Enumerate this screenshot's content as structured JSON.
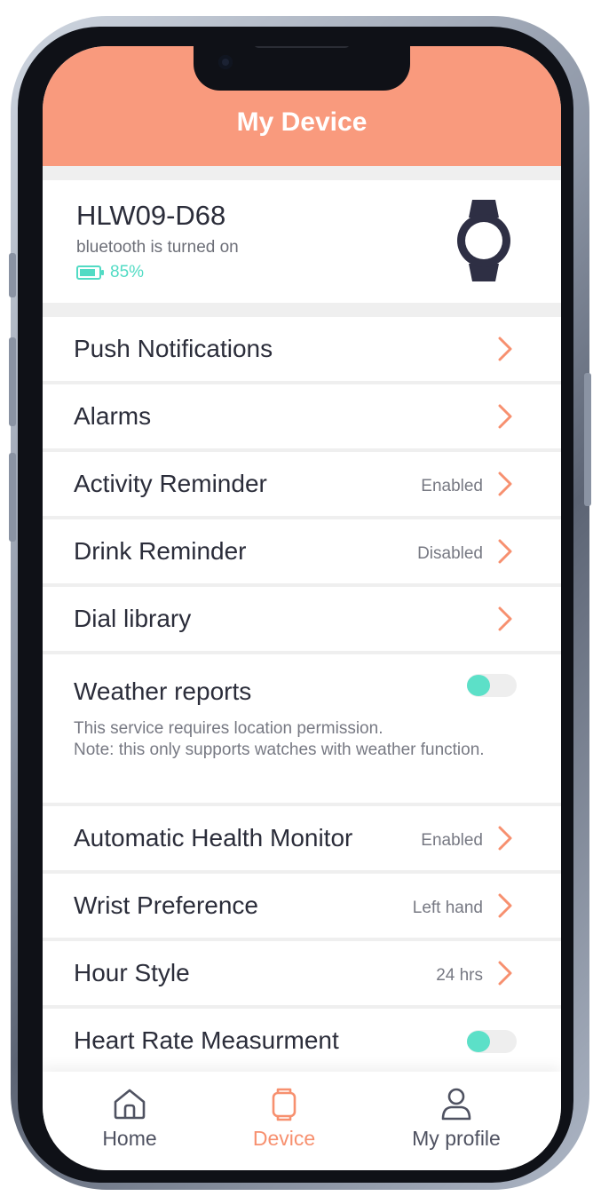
{
  "header": {
    "title": "My Device"
  },
  "device": {
    "name": "HLW09-D68",
    "bluetooth_status": "bluetooth is turned on",
    "battery_percent": "85%",
    "battery_level": 0.85
  },
  "settings": [
    {
      "label": "Push Notifications",
      "value": ""
    },
    {
      "label": "Alarms",
      "value": ""
    },
    {
      "label": "Activity Reminder",
      "value": "Enabled"
    },
    {
      "label": "Drink Reminder",
      "value": "Disabled"
    },
    {
      "label": "Dial library",
      "value": ""
    }
  ],
  "weather": {
    "label": "Weather reports",
    "description_line1": "This service requires location permission.",
    "description_line2": "Note: this only supports watches with weather function.",
    "toggle_on": false
  },
  "settings2": [
    {
      "label": "Automatic Health Monitor",
      "value": "Enabled"
    },
    {
      "label": "Wrist Preference",
      "value": "Left hand"
    },
    {
      "label": "Hour Style",
      "value": "24 hrs"
    }
  ],
  "heart_rate": {
    "label": "Heart Rate Measurment",
    "toggle_on": false
  },
  "tabs": [
    {
      "label": "Home",
      "icon": "home-icon",
      "active": false
    },
    {
      "label": "Device",
      "icon": "watch-outline-icon",
      "active": true
    },
    {
      "label": "My profile",
      "icon": "user-icon",
      "active": false
    }
  ],
  "colors": {
    "header_bg": "#f99a7d",
    "accent": "#f7906f",
    "battery": "#52dbc4",
    "toggle_knob": "#5ce0c8"
  }
}
